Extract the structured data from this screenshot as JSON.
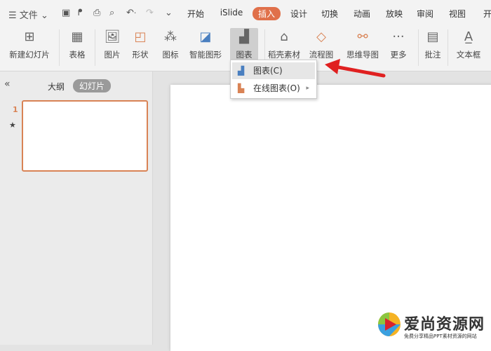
{
  "quickbar": {
    "menu_label": "文件",
    "icons": [
      "save-icon",
      "format-painter-icon",
      "print-icon",
      "print-preview-icon",
      "undo-icon",
      "redo-icon",
      "customize-icon"
    ]
  },
  "tabs": [
    {
      "label": "开始"
    },
    {
      "label": "iSlide"
    },
    {
      "label": "插入",
      "active": true
    },
    {
      "label": "设计"
    },
    {
      "label": "切换"
    },
    {
      "label": "动画"
    },
    {
      "label": "放映"
    },
    {
      "label": "审阅"
    },
    {
      "label": "视图"
    },
    {
      "label": "开"
    }
  ],
  "ribbon": [
    {
      "label": "新建幻灯片",
      "icon": "new-slide-icon"
    },
    {
      "label": "表格",
      "icon": "table-icon"
    },
    {
      "label": "图片",
      "icon": "picture-icon"
    },
    {
      "label": "形状",
      "icon": "shape-icon"
    },
    {
      "label": "图标",
      "icon": "icons-icon"
    },
    {
      "label": "智能图形",
      "icon": "smartart-icon"
    },
    {
      "label": "图表",
      "icon": "chart-icon",
      "selected": true
    },
    {
      "label": "稻壳素材",
      "icon": "docer-material-icon"
    },
    {
      "label": "流程图",
      "icon": "flowchart-icon"
    },
    {
      "label": "思维导图",
      "icon": "mindmap-icon"
    },
    {
      "label": "更多",
      "icon": "more-icon"
    },
    {
      "label": "批注",
      "icon": "comment-icon"
    },
    {
      "label": "文本框",
      "icon": "textbox-icon"
    }
  ],
  "dropdown": {
    "items": [
      {
        "label": "图表(C)",
        "icon": "chart-icon"
      },
      {
        "label": "在线图表(O)",
        "icon": "online-chart-icon",
        "submenu": true
      }
    ]
  },
  "panel": {
    "tab_outline": "大纲",
    "tab_slides": "幻灯片",
    "slide_number": "1"
  },
  "watermark": {
    "title": "爱尚资源网",
    "subtitle": "免费分享精品PPT素材资源的网站"
  },
  "colors": {
    "accent": "#e0704a",
    "arrow": "#e02020"
  }
}
